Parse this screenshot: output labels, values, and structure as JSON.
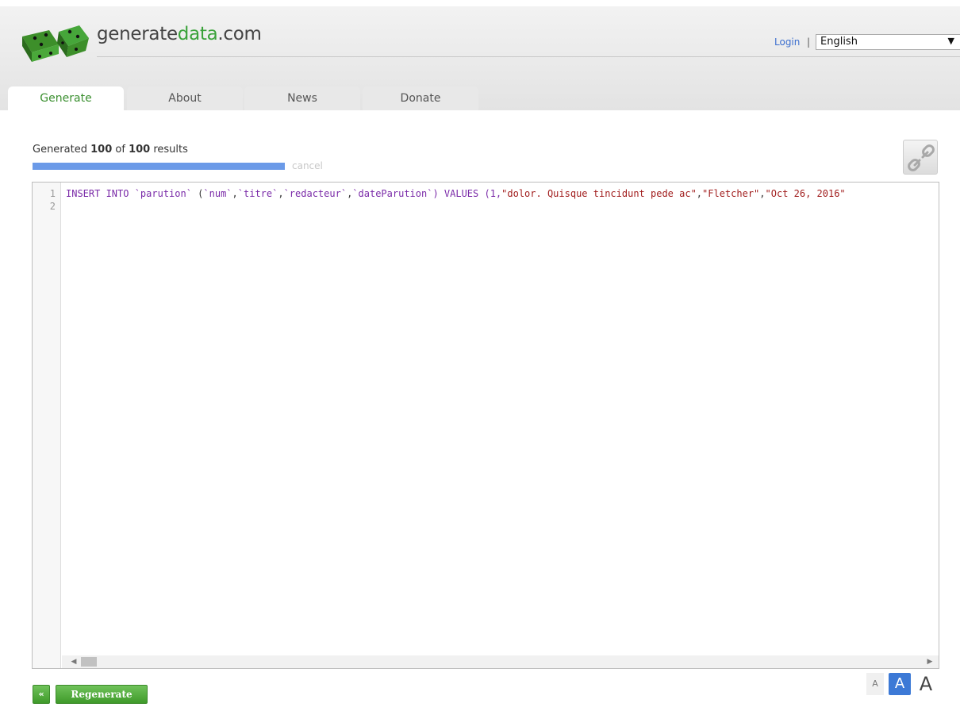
{
  "header": {
    "site_name_prefix": "generate",
    "site_name_accent": "data",
    "site_name_suffix": ".com",
    "login_label": "Login",
    "separator": "|",
    "language": "English",
    "logo_icon": "green-dice-icon"
  },
  "tabs": [
    {
      "label": "Generate",
      "active": true
    },
    {
      "label": "About",
      "active": false
    },
    {
      "label": "News",
      "active": false
    },
    {
      "label": "Donate",
      "active": false
    }
  ],
  "status": {
    "prefix": "Generated",
    "generated": "100",
    "middle": "of",
    "total": "100",
    "suffix": "results",
    "progress_fraction": 1.0,
    "cancel_label": "cancel"
  },
  "editor": {
    "line_numbers": [
      "1",
      "2"
    ],
    "line1": {
      "t1": "INSERT INTO ",
      "t2": "`parution`",
      "t3": " (",
      "t4": "`num`",
      "t5": ",",
      "t6": "`titre`",
      "t7": ",",
      "t8": "`redacteur`",
      "t9": ",",
      "t10": "`dateParution`",
      "t11": ") VALUES (1,",
      "t12": "\"dolor. Quisque tincidunt pede ac\"",
      "t13": ",",
      "t14": "\"Fletcher\"",
      "t15": ",",
      "t16": "\"Oct 26, 2016\""
    }
  },
  "controls": {
    "back_label": "«",
    "regenerate_label": "Regenerate",
    "font_small": "A",
    "font_medium": "A",
    "font_large": "A"
  },
  "colors": {
    "accent_green": "#3aa23a",
    "progress_blue": "#6b9ae8",
    "link_blue": "#3c6fcf",
    "font_selected_blue": "#3c79d6"
  }
}
